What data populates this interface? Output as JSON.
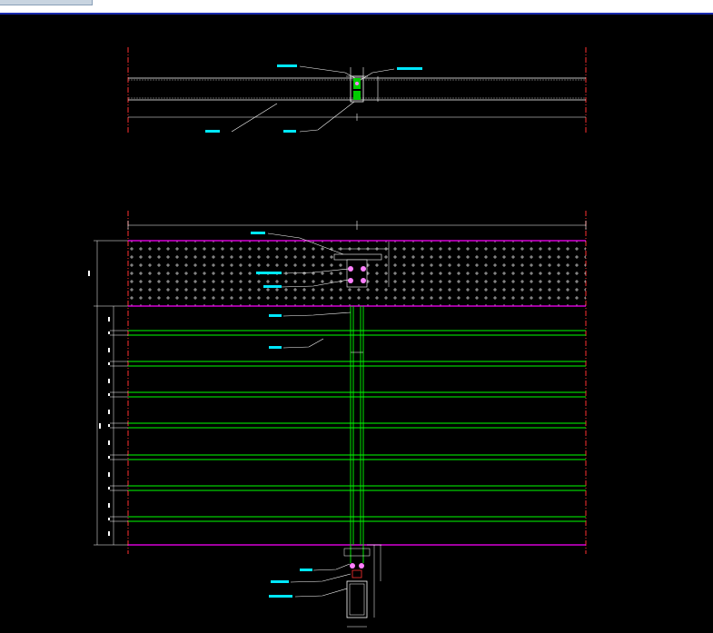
{
  "colors": {
    "background": "#000000",
    "axis_line": "#ff3030",
    "panel_line": "#ff00ff",
    "glass_line": "#00ff00",
    "leader": "#ffffff",
    "label": "#00e8ff",
    "connector": "#ff80ff",
    "topbar": "#ffffff",
    "topline": "#1a2bb0"
  },
  "stone_rows": 8,
  "glass_bands": 8
}
